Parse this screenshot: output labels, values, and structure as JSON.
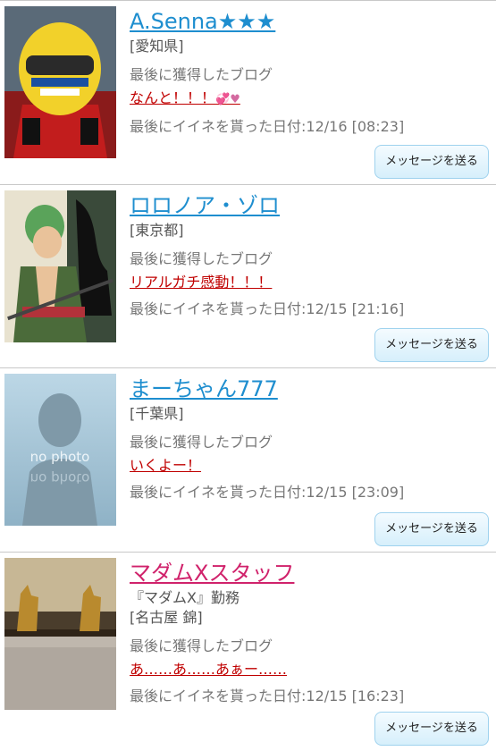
{
  "button_label": "メッセージを送る",
  "last_blog_label": "最後に獲得したブログ",
  "users": [
    {
      "name": "A.Senna★★★",
      "location": "[愛知県]",
      "blog_title": "なんと！！！",
      "blog_icons": "💞♥",
      "last_like": "最後にイイネを貰った日付:12/16 [08:23]"
    },
    {
      "name": "ロロノア・ゾロ",
      "location": "[東京都]",
      "blog_title": "リアルガチ感動！！！",
      "last_like": "最後にイイネを貰った日付:12/15 [21:16]"
    },
    {
      "name": "まーちゃん777",
      "location": "[千葉県]",
      "blog_title": "いくよー！",
      "photo_text": "no photo",
      "last_like": "最後にイイネを貰った日付:12/15 [23:09]"
    },
    {
      "name": "マダムXスタッフ",
      "workplace": "『マダムX』勤務",
      "location": "[名古屋 錦]",
      "blog_title": "あ……あ……あぁー……",
      "last_like": "最後にイイネを貰った日付:12/15 [16:23]"
    }
  ],
  "colors": {
    "link": "#1e8ecf",
    "staff_link": "#d0226b",
    "blog_link": "#c00000"
  }
}
